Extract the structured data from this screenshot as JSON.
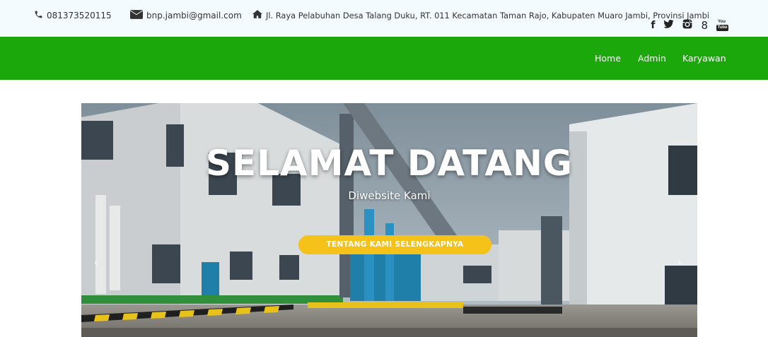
{
  "topbar": {
    "phone": "081373520115",
    "email": "bnp.jambi@gmail.com",
    "address": "Jl. Raya Pelabuhan Desa Talang Duku, RT. 011 Kecamatan Taman Rajo, Kabupaten Muaro Jambi, Provinsi Jambi",
    "social": [
      "facebook-icon",
      "twitter-icon",
      "instagram-icon",
      "google-plus-icon",
      "youtube-icon"
    ],
    "social_glyphs": {
      "facebook": "f",
      "google_plus": "8",
      "youtube_top": "You",
      "youtube_bottom": "Tube"
    }
  },
  "nav": {
    "home": "Home",
    "admin": "Admin",
    "karyawan": "Karyawan"
  },
  "hero": {
    "title": "SELAMAT DATANG",
    "subtitle": "Diwebsite Kami",
    "button": "TENTANG KAMI SELENGKAPNYA",
    "prev": "‹",
    "next": "›"
  },
  "colors": {
    "nav_bg": "#1aa80b",
    "button_bg": "#f5c21a",
    "topbar_bg": "#f4fbff"
  }
}
